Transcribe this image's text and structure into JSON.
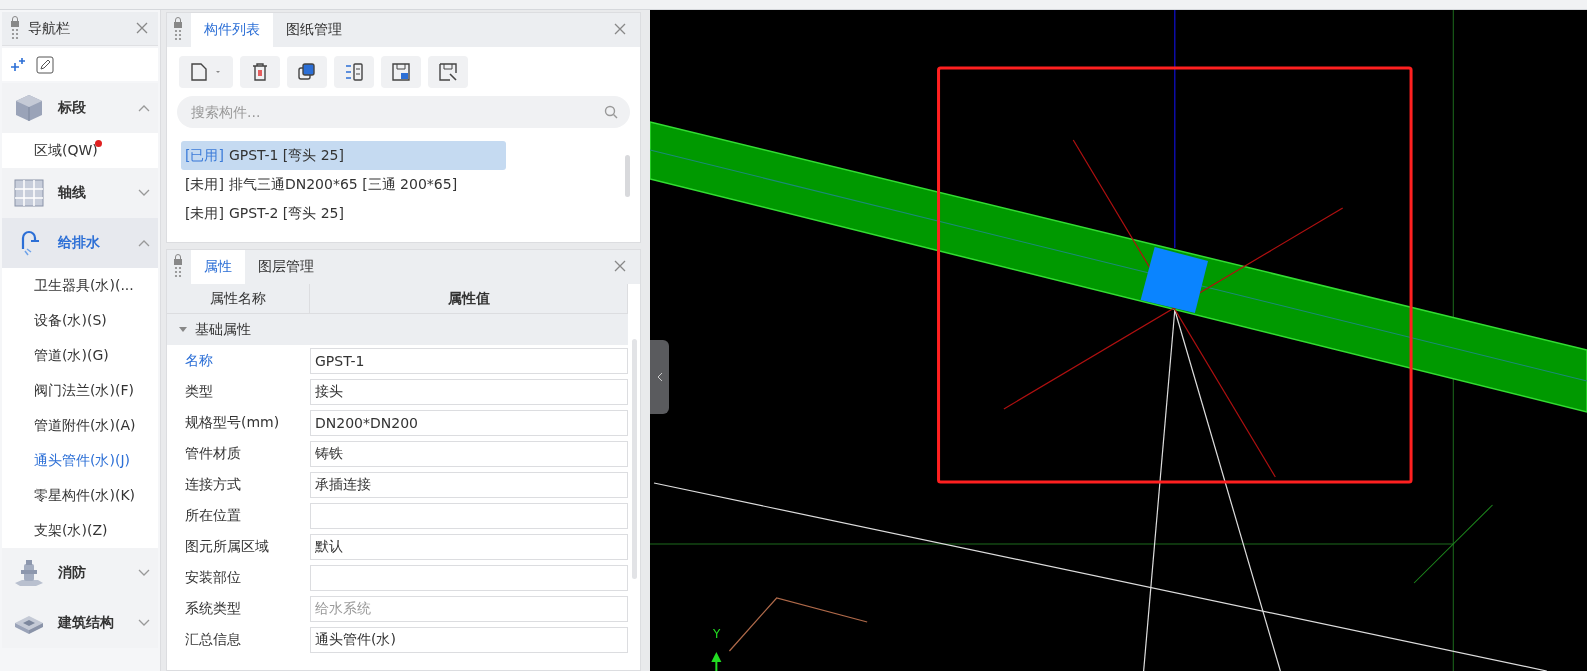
{
  "navigation": {
    "title": "导航栏",
    "sections": [
      {
        "label": "标段",
        "kind": "cube",
        "expanded": true,
        "selected": false,
        "items": [
          {
            "label": "区域(QW)",
            "selected": false,
            "flagged": true
          }
        ]
      },
      {
        "label": "轴线",
        "kind": "grid",
        "expanded": false,
        "selected": false
      },
      {
        "label": "给排水",
        "kind": "faucet",
        "expanded": true,
        "selected": true,
        "items": [
          {
            "label": "卫生器具(水)(...",
            "selected": false,
            "flagged": false
          },
          {
            "label": "设备(水)(S)",
            "selected": false,
            "flagged": false
          },
          {
            "label": "管道(水)(G)",
            "selected": false,
            "flagged": false
          },
          {
            "label": "阀门法兰(水)(F)",
            "selected": false,
            "flagged": false
          },
          {
            "label": "管道附件(水)(A)",
            "selected": false,
            "flagged": false
          },
          {
            "label": "通头管件(水)(J)",
            "selected": true,
            "flagged": false
          },
          {
            "label": "零星构件(水)(K)",
            "selected": false,
            "flagged": false
          },
          {
            "label": "支架(水)(Z)",
            "selected": false,
            "flagged": false
          }
        ]
      },
      {
        "label": "消防",
        "kind": "hydrant",
        "expanded": false,
        "selected": false
      },
      {
        "label": "建筑结构",
        "kind": "structure",
        "expanded": false,
        "selected": false
      }
    ]
  },
  "component_panel": {
    "tabs": [
      {
        "label": "构件列表",
        "selected": true
      },
      {
        "label": "图纸管理",
        "selected": false
      }
    ],
    "search": {
      "placeholder": "搜索构件..."
    },
    "items": [
      {
        "status": "[已用]",
        "text": "GPST-1 [弯头 25]",
        "selected": true
      },
      {
        "status": "[未用]",
        "text": "排气三通DN200*65 [三通 200*65]",
        "selected": false
      },
      {
        "status": "[未用]",
        "text": "GPST-2 [弯头 25]",
        "selected": false
      }
    ]
  },
  "properties_panel": {
    "tabs": [
      {
        "label": "属性",
        "selected": true
      },
      {
        "label": "图层管理",
        "selected": false
      }
    ],
    "columns": [
      "属性名称",
      "属性值"
    ],
    "group": {
      "label": "基础属性",
      "expanded": true
    },
    "rows": [
      {
        "name": "名称",
        "value": "GPST-1",
        "selected": true,
        "disabled": false
      },
      {
        "name": "类型",
        "value": "接头",
        "selected": false,
        "disabled": false
      },
      {
        "name": "规格型号(mm)",
        "value": "DN200*DN200",
        "selected": false,
        "disabled": false
      },
      {
        "name": "管件材质",
        "value": "铸铁",
        "selected": false,
        "disabled": false
      },
      {
        "name": "连接方式",
        "value": "承插连接",
        "selected": false,
        "disabled": false
      },
      {
        "name": "所在位置",
        "value": "",
        "selected": false
      },
      {
        "name": "图元所属区域",
        "value": "默认",
        "selected": false,
        "disabled": false
      },
      {
        "name": "安装部位",
        "value": "",
        "selected": false
      },
      {
        "name": "系统类型",
        "value": "给水系统",
        "selected": false,
        "disabled": true
      },
      {
        "name": "汇总信息",
        "value": "通头管件(水)",
        "selected": false,
        "disabled": false
      }
    ]
  },
  "viewport": {
    "axis_label": "Y"
  }
}
